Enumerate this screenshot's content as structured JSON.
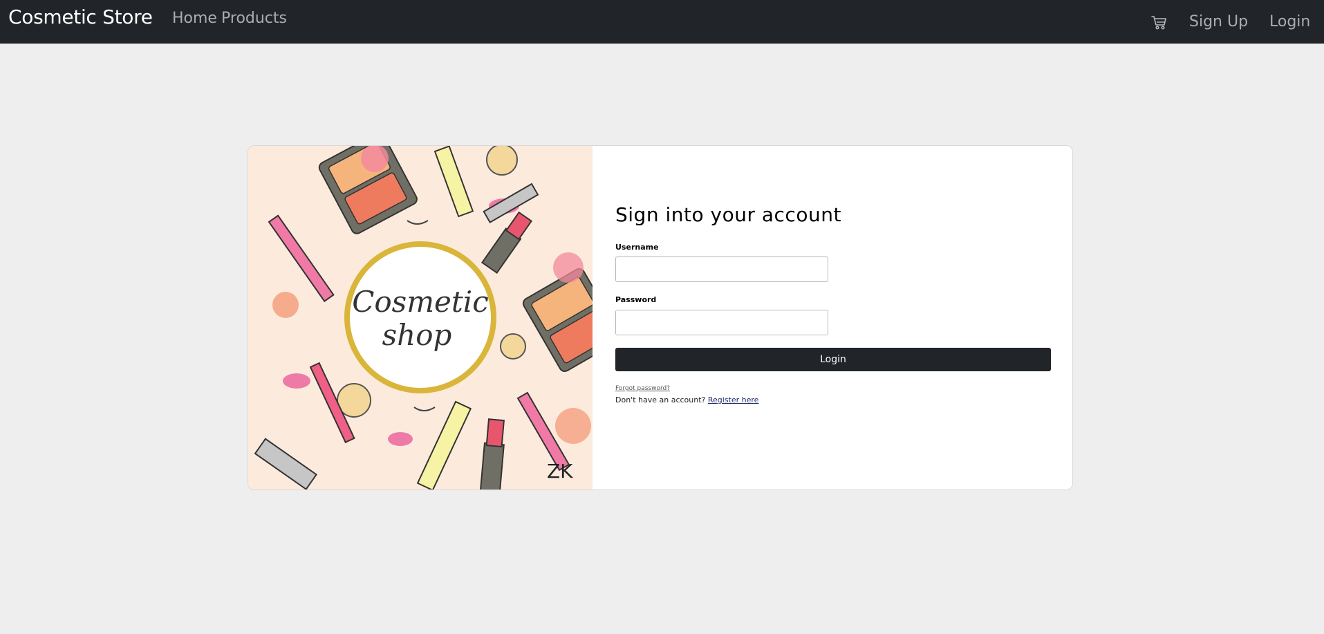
{
  "navbar": {
    "brand": "Cosmetic Store",
    "links": [
      "Home",
      "Products"
    ],
    "cart_icon": "cart-icon",
    "signup_label": "Sign Up",
    "login_label": "Login"
  },
  "hero": {
    "logo_line1": "Cosmetic",
    "logo_line2": "shop",
    "watermark": "ZK"
  },
  "form": {
    "heading": "Sign into your account",
    "username_label": "Username",
    "username_value": "",
    "password_label": "Password",
    "password_value": "",
    "submit_label": "Login",
    "forgot_label": "Forgot password?",
    "register_prompt": "Don't have an account? ",
    "register_link": "Register here"
  },
  "colors": {
    "navbar_bg": "#212529",
    "page_bg": "#eeeeee",
    "art_bg": "#fcebdd",
    "button_bg": "#212529"
  }
}
